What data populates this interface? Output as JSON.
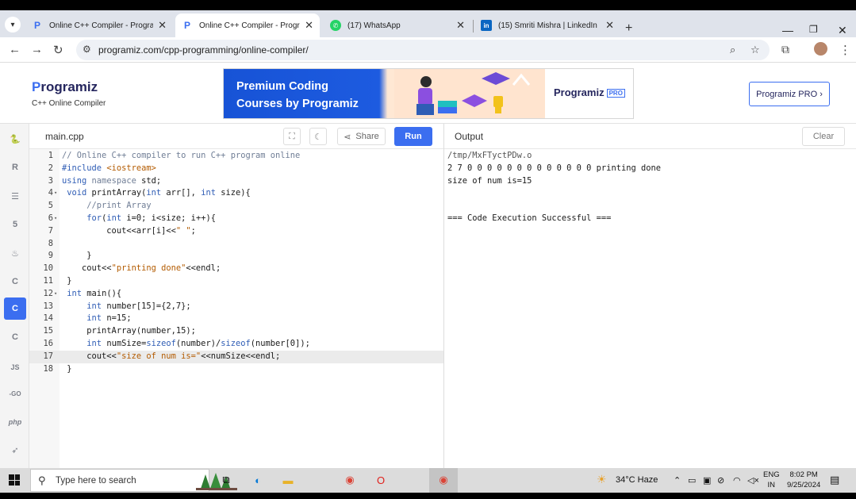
{
  "browser": {
    "tabs": [
      {
        "title": "Online C++ Compiler - Program",
        "favicon": "programiz-icon"
      },
      {
        "title": "Online C++ Compiler - Program",
        "favicon": "programiz-icon"
      },
      {
        "title": "(17) WhatsApp",
        "favicon": "whatsapp-icon"
      },
      {
        "title": "(15) Smriti Mishra | LinkedIn",
        "favicon": "linkedin-icon"
      }
    ],
    "url": "programiz.com/cpp-programming/online-compiler/"
  },
  "site": {
    "logo": "Programiz",
    "logo_sub": "C++ Online Compiler",
    "banner_line1": "Premium Coding",
    "banner_line2": "Courses by Programiz",
    "banner_brand": "Programiz",
    "banner_pro": "PRO",
    "pro_button": "Programiz PRO ›"
  },
  "editor": {
    "filename": "main.cpp",
    "share_label": "Share",
    "run_label": "Run",
    "lines": [
      {
        "n": "1",
        "fold": "",
        "html": [
          [
            "cm",
            "// Online C++ compiler to run C++ program online"
          ]
        ]
      },
      {
        "n": "2",
        "fold": "",
        "html": [
          [
            "kw",
            "#include "
          ],
          [
            "str",
            "<iostream>"
          ]
        ]
      },
      {
        "n": "3",
        "fold": "",
        "html": [
          [
            "kw",
            "using "
          ],
          [
            "cm",
            "namespace "
          ],
          [
            "tx",
            "std;"
          ]
        ]
      },
      {
        "n": "4",
        "fold": "▾",
        "html": [
          [
            "tx",
            " "
          ],
          [
            "kw",
            "void "
          ],
          [
            "tx",
            "printArray("
          ],
          [
            "kw",
            "int "
          ],
          [
            "tx",
            "arr[], "
          ],
          [
            "kw",
            "int "
          ],
          [
            "tx",
            "size){"
          ]
        ]
      },
      {
        "n": "5",
        "fold": "",
        "html": [
          [
            "cm",
            "     //print Array"
          ]
        ]
      },
      {
        "n": "6",
        "fold": "▾",
        "html": [
          [
            "tx",
            "     "
          ],
          [
            "kw",
            "for"
          ],
          [
            "tx",
            "("
          ],
          [
            "kw",
            "int "
          ],
          [
            "tx",
            "i=0; i<size; i++){"
          ]
        ]
      },
      {
        "n": "7",
        "fold": "",
        "html": [
          [
            "tx",
            "         cout<<arr[i]<<"
          ],
          [
            "str",
            "\" \""
          ],
          [
            "tx",
            ";"
          ]
        ]
      },
      {
        "n": "8",
        "fold": "",
        "html": [
          [
            "tx",
            "         "
          ]
        ]
      },
      {
        "n": "9",
        "fold": "",
        "html": [
          [
            "tx",
            "     }"
          ]
        ]
      },
      {
        "n": "10",
        "fold": "",
        "html": [
          [
            "tx",
            "    cout<<"
          ],
          [
            "str",
            "\"printing done\""
          ],
          [
            "tx",
            "<<endl;"
          ]
        ]
      },
      {
        "n": "11",
        "fold": "",
        "html": [
          [
            "tx",
            " }"
          ]
        ]
      },
      {
        "n": "12",
        "fold": "▾",
        "html": [
          [
            "tx",
            " "
          ],
          [
            "kw",
            "int "
          ],
          [
            "tx",
            "main(){"
          ]
        ]
      },
      {
        "n": "13",
        "fold": "",
        "html": [
          [
            "tx",
            "     "
          ],
          [
            "kw",
            "int "
          ],
          [
            "tx",
            "number[15]={2,7};"
          ]
        ]
      },
      {
        "n": "14",
        "fold": "",
        "html": [
          [
            "tx",
            "     "
          ],
          [
            "kw",
            "int "
          ],
          [
            "tx",
            "n=15;"
          ]
        ]
      },
      {
        "n": "15",
        "fold": "",
        "html": [
          [
            "tx",
            "     printArray(number,15);"
          ]
        ]
      },
      {
        "n": "16",
        "fold": "",
        "html": [
          [
            "tx",
            "     "
          ],
          [
            "kw",
            "int "
          ],
          [
            "tx",
            "numSize="
          ],
          [
            "kw",
            "sizeof"
          ],
          [
            "tx",
            "(number)/"
          ],
          [
            "kw",
            "sizeof"
          ],
          [
            "tx",
            "(number[0]);"
          ]
        ]
      },
      {
        "n": "17",
        "fold": "",
        "html": [
          [
            "tx",
            "     cout<<"
          ],
          [
            "str",
            "\"size of num is=\""
          ],
          [
            "tx",
            "<<numSize<<endl;"
          ]
        ]
      },
      {
        "n": "18",
        "fold": "",
        "html": [
          [
            "tx",
            " }"
          ]
        ]
      }
    ],
    "highlight_line": 17
  },
  "output": {
    "title": "Output",
    "clear_label": "Clear",
    "lines": [
      "/tmp/MxFTyctPDw.o",
      "2 7 0 0 0 0 0 0 0 0 0 0 0 0 0 printing done",
      "size of num is=15",
      "",
      "",
      "=== Code Execution Successful ==="
    ]
  },
  "sidebar": [
    "python-icon",
    "r-icon",
    "sql-icon",
    "html-icon",
    "java-icon",
    "c-icon",
    "cpp-icon",
    "csharp-icon",
    "js-icon",
    "go-icon",
    "php-icon",
    "swift-icon"
  ],
  "sidebar_labels": {
    "js": "JS",
    "go": "-GO",
    "php": "php"
  },
  "taskbar": {
    "search_placeholder": "Type here to search",
    "weather": "34°C  Haze",
    "lang1": "ENG",
    "lang2": "IN",
    "time": "8:02 PM",
    "date": "9/25/2024"
  },
  "colors": {
    "accent": "#3b6ef0",
    "brand_dark": "#25265e"
  }
}
